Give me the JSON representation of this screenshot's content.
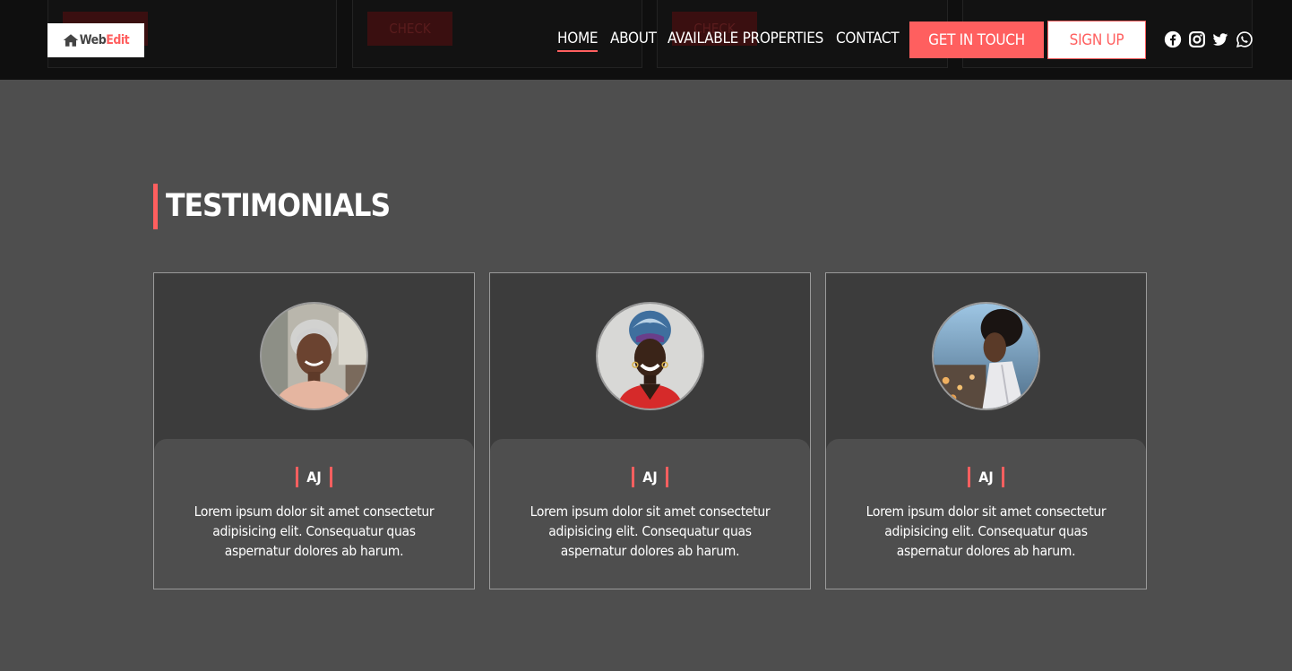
{
  "header": {
    "logo_prefix": "Web",
    "logo_suffix": "Edit",
    "background_check_label": "CHECK",
    "nav": [
      {
        "label": "HOME",
        "active": true
      },
      {
        "label": "ABOUT"
      },
      {
        "label": "AVAILABLE PROPERTIES"
      },
      {
        "label": "CONTACT"
      }
    ],
    "get_in_touch": "GET IN TOUCH",
    "sign_up": "SIGN UP",
    "social_icons": [
      "facebook-icon",
      "instagram-icon",
      "twitter-icon",
      "whatsapp-icon"
    ]
  },
  "testimonials": {
    "title": "TESTIMONIALS",
    "cards": [
      {
        "name": "AJ",
        "quote": "Lorem ipsum dolor sit amet consectetur adipisicing elit. Consequatur quas aspernatur dolores ab harum."
      },
      {
        "name": "AJ",
        "quote": "Lorem ipsum dolor sit amet consectetur adipisicing elit. Consequatur quas aspernatur dolores ab harum."
      },
      {
        "name": "AJ",
        "quote": "Lorem ipsum dolor sit amet consectetur adipisicing elit. Consequatur quas aspernatur dolores ab harum."
      }
    ]
  },
  "colors": {
    "accent": "#ff5f5f",
    "page_bg": "#4e4e4e",
    "header_bg": "#0f0f0f",
    "card_top_bg": "#3c3c3c"
  }
}
